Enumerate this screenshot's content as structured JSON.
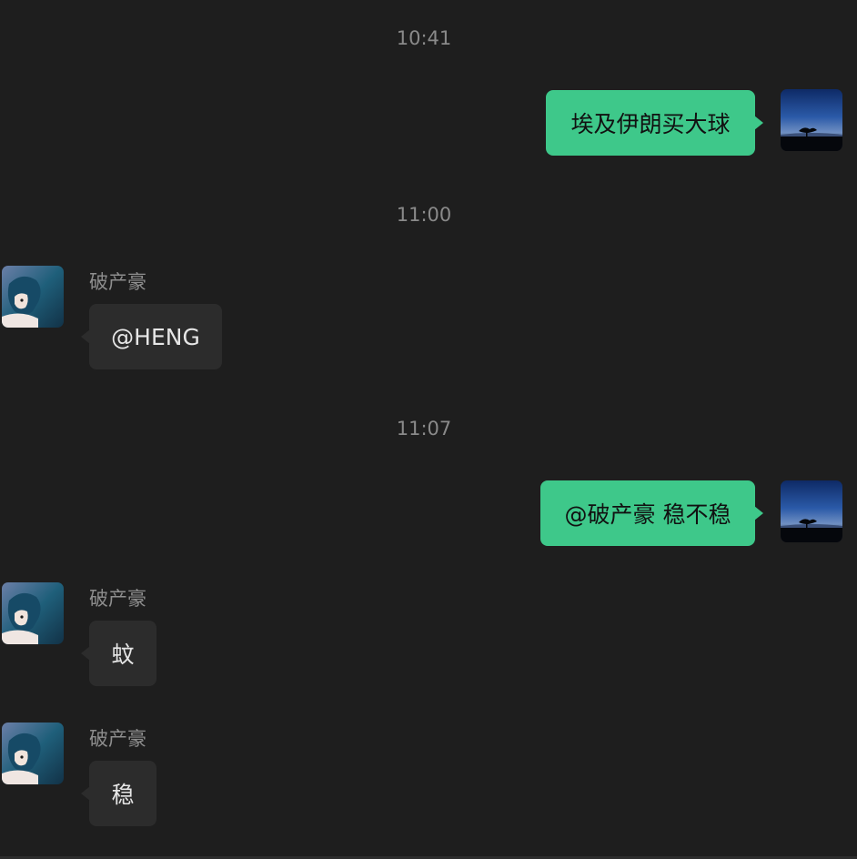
{
  "colors": {
    "background": "#1e1e1e",
    "outgoing_bubble": "#3ec88a",
    "incoming_bubble": "#2c2c2c",
    "timestamp_text": "#8a8a8a"
  },
  "timestamps": [
    "10:41",
    "11:00",
    "11:07"
  ],
  "messages": [
    {
      "direction": "outgoing",
      "text": "埃及伊朗买大球",
      "avatar_icon": "night-sky-tree-avatar"
    },
    {
      "direction": "incoming",
      "sender": "破产豪",
      "text": "@HENG",
      "avatar_icon": "anime-girl-avatar"
    },
    {
      "direction": "outgoing",
      "text": "@破产豪 稳不稳",
      "avatar_icon": "night-sky-tree-avatar"
    },
    {
      "direction": "incoming",
      "sender": "破产豪",
      "text": "蚊",
      "avatar_icon": "anime-girl-avatar"
    },
    {
      "direction": "incoming",
      "sender": "破产豪",
      "text": "稳",
      "avatar_icon": "anime-girl-avatar"
    }
  ]
}
